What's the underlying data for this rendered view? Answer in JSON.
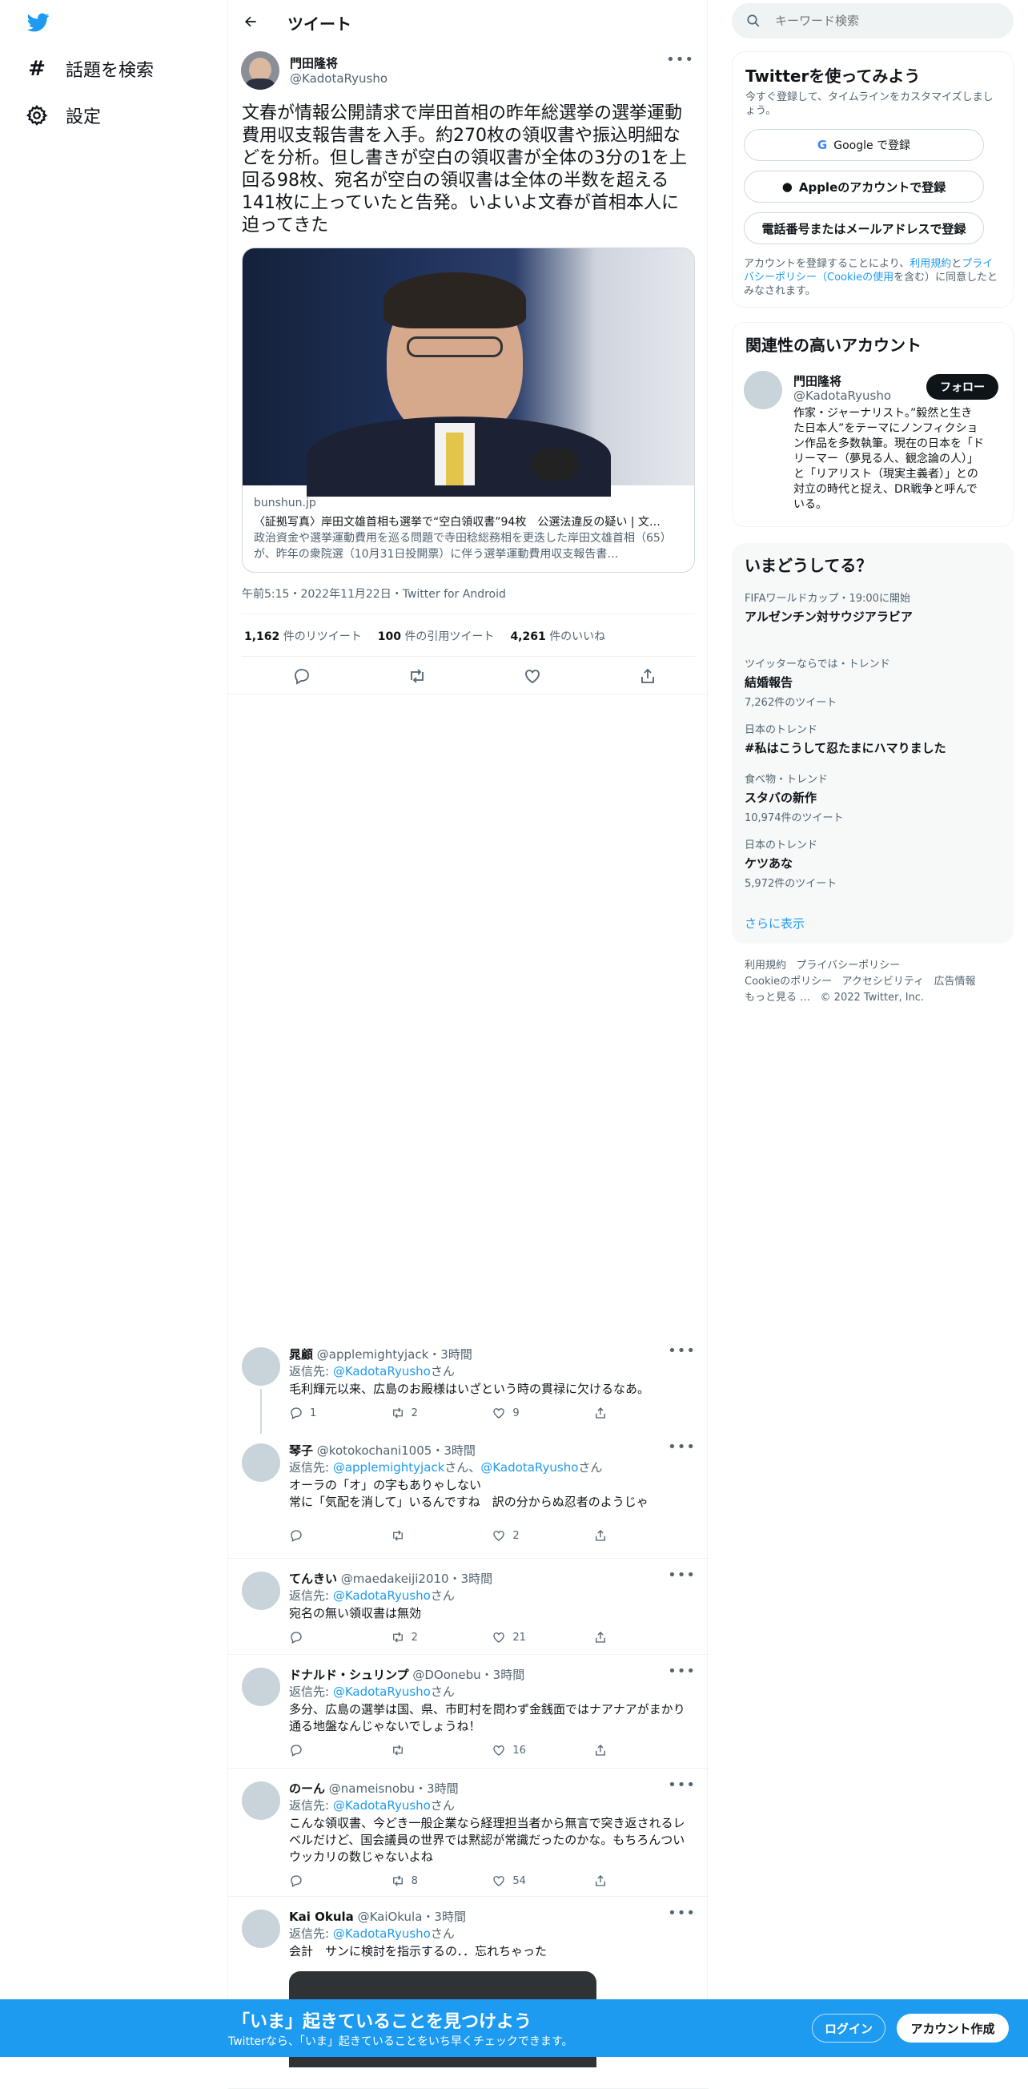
{
  "nav": {
    "explore": "話題を検索",
    "settings": "設定"
  },
  "header": {
    "title": "ツイート"
  },
  "tweet": {
    "author_name": "門田隆将",
    "author_handle": "@KadotaRyusho",
    "text": "文春が情報公開請求で岸田首相の昨年総選挙の選挙運動費用収支報告書を入手。約270枚の領収書や振込明細などを分析。但し書きが空白の領収書が全体の3分の1を上回る98枚、宛名が空白の領収書は全体の半数を超える141枚に上っていたと告発。いよいよ文春が首相本人に迫ってきた",
    "card": {
      "domain": "bunshun.jp",
      "title": "〈証拠写真〉岸田文雄首相も選挙で“空白領収書”94枚　公選法違反の疑い | 文…",
      "desc": "政治資金や選挙運動費用を巡る問題で寺田稔総務相を更迭した岸田文雄首相（65）が、昨年の衆院選（10月31日投開票）に伴う選挙運動費用収支報告書…"
    },
    "meta": "午前5:15・2022年11月22日・Twitter for Android",
    "retweets_count": "1,162",
    "retweets_label": "件のリツイート",
    "quotes_count": "100",
    "quotes_label": "件の引用ツイート",
    "likes_count": "4,261",
    "likes_label": "件のいいね"
  },
  "replies": [
    {
      "name": "晁顧",
      "handle": "@applemightyjack",
      "time": "・3時間",
      "reply_to_label": "返信先: ",
      "reply_to": [
        "@KadotaRyusho"
      ],
      "san": "さん",
      "lines": [
        "毛利輝元以来、広島のお殿様はいざという時の貫禄に欠けるなあ。"
      ],
      "replies": "1",
      "retweets": "2",
      "likes": "9"
    },
    {
      "name": "琴子",
      "handle": "@kotokochani1005",
      "time": "・3時間",
      "reply_to_label": "返信先: ",
      "reply_to": [
        "@applemightyjack",
        "@KadotaRyusho"
      ],
      "san": "さん",
      "lines": [
        "オーラの「オ」の字もありゃしない",
        "常に「気配を消して」いるんですね　訳の分からぬ忍者のようじゃ"
      ],
      "replies": "",
      "retweets": "",
      "likes": "2"
    },
    {
      "name": "てんきい",
      "handle": "@maedakeiji2010",
      "time": "・3時間",
      "reply_to_label": "返信先: ",
      "reply_to": [
        "@KadotaRyusho"
      ],
      "san": "さん",
      "lines": [
        "宛名の無い領収書は無効"
      ],
      "replies": "",
      "retweets": "2",
      "likes": "21"
    },
    {
      "name": "ドナルド・シュリンプ",
      "handle": "@DOonebu",
      "time": "・3時間",
      "reply_to_label": "返信先: ",
      "reply_to": [
        "@KadotaRyusho"
      ],
      "san": "さん",
      "lines": [
        "多分、広島の選挙は国、県、市町村を問わず金銭面ではナアナアがまかり",
        "通る地盤なんじゃないでしょうね！"
      ],
      "replies": "",
      "retweets": "",
      "likes": "16"
    },
    {
      "name": "のーん",
      "handle": "@nameisnobu",
      "time": "・3時間",
      "reply_to_label": "返信先: ",
      "reply_to": [
        "@KadotaRyusho"
      ],
      "san": "さん",
      "lines": [
        "こんな領収書、今どき一般企業なら経理担当者から無言で突き返されるレ",
        "ベルだけど、国会議員の世界では黙認が常識だったのかな。もちろんつい",
        "ウッカリの数じゃないよね"
      ],
      "replies": "",
      "retweets": "8",
      "likes": "54"
    },
    {
      "name": "Kai Okula",
      "handle": "@KaiOkula",
      "time": "・3時間",
      "reply_to_label": "返信先: ",
      "reply_to": [
        "@KadotaRyusho"
      ],
      "san": "さん",
      "lines": [
        "会計　サンに検討を指示するの．．忘れちゃった"
      ],
      "replies": "",
      "retweets": "",
      "likes": ""
    }
  ],
  "search": {
    "placeholder": "キーワード検索"
  },
  "signup": {
    "title": "Twitterを使ってみよう",
    "subtitle": "今すぐ登録して、タイムラインをカスタマイズしましょう。",
    "google": "Google で登録",
    "apple": "Appleのアカウントで登録",
    "phone": "電話番号またはメールアドレスで登録",
    "legal_1": "アカウントを登録することにより、",
    "legal_terms": "利用規約",
    "legal_and": "と",
    "legal_privacy": "プライバシーポリシー",
    "legal_cookie": "（Cookieの使用",
    "legal_2": "を含む）に同意したとみなされます。"
  },
  "related": {
    "title": "関連性の高いアカウント",
    "name": "門田隆将",
    "handle": "@KadotaRyusho",
    "follow": "フォロー",
    "bio_lines": [
      "作家・ジャーナリスト。”毅然と生き",
      "た日本人”をテーマにノンフィクショ",
      "ン作品を多数執筆。現在の日本を「ド",
      "リーマー（夢見る人、観念論の人）」",
      "と「リアリスト（現実主義者）」との",
      "対立の時代と捉え、DR戦争と呼んで",
      "いる。"
    ]
  },
  "trends": {
    "title": "いまどうしてる？",
    "items": [
      {
        "context": "FIFAワールドカップ・19:00に開始",
        "name": "アルゼンチン対サウジアラビア",
        "count": ""
      },
      {
        "context": "ツイッターならでは・トレンド",
        "name": "結婚報告",
        "count": "7,262件のツイート"
      },
      {
        "context": "日本のトレンド",
        "name": "#私はこうして忍たまにハマりました",
        "count": ""
      },
      {
        "context": "食べ物・トレンド",
        "name": "スタバの新作",
        "count": "10,974件のツイート"
      },
      {
        "context": "日本のトレンド",
        "name": "ケツあな",
        "count": "5,972件のツイート"
      }
    ],
    "more": "さらに表示"
  },
  "footer": {
    "terms": "利用規約",
    "privacy": "プライバシーポリシー",
    "cookie": "Cookieのポリシー",
    "access": "アクセシビリティ",
    "ads": "広告情報",
    "more": "もっと見る …",
    "copyright": "© 2022 Twitter, Inc."
  },
  "bottom_bar": {
    "title": "「いま」起きていることを見つけよう",
    "subtitle": "Twitterなら、「いま」起きていることをいち早くチェックできます。",
    "login": "ログイン",
    "signup": "アカウント作成"
  },
  "colors": {
    "brand": "#1d9bf0",
    "dark": "#0f1419",
    "muted": "#536471"
  }
}
